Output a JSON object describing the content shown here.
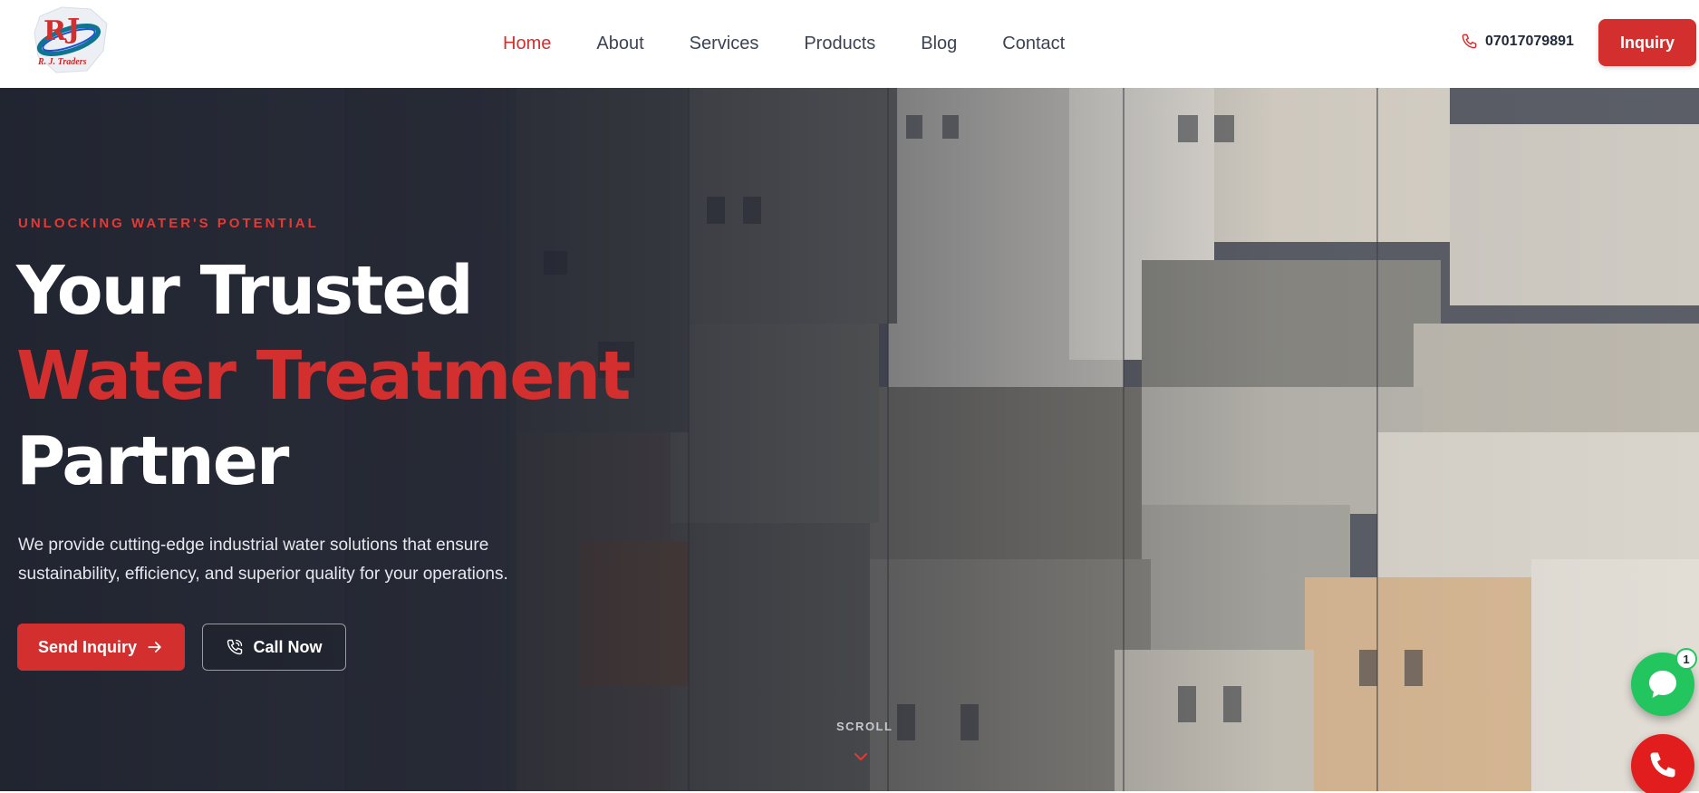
{
  "header": {
    "logo": {
      "mark": "RJ",
      "name": "R. J. Traders",
      "colors": {
        "red": "#d32f2f",
        "blue": "#1d4ed8",
        "teal": "#0e7490"
      }
    },
    "nav": [
      {
        "label": "Home",
        "active": true
      },
      {
        "label": "About",
        "active": false
      },
      {
        "label": "Services",
        "active": false
      },
      {
        "label": "Products",
        "active": false
      },
      {
        "label": "Blog",
        "active": false
      },
      {
        "label": "Contact",
        "active": false
      }
    ],
    "phone": {
      "icon": "phone-icon",
      "number": "07017079891"
    },
    "inquiry_label": "Inquiry"
  },
  "hero": {
    "eyebrow": "UNLOCKING WATER'S POTENTIAL",
    "heading_line1": "Your Trusted",
    "heading_line2": "Water Treatment",
    "heading_line3": "Partner",
    "description": "We provide cutting-edge industrial water solutions that ensure sustainability, efficiency, and superior quality for your operations.",
    "primary_button": {
      "label": "Send Inquiry",
      "icon": "arrow-right-icon"
    },
    "secondary_button": {
      "label": "Call Now",
      "icon": "phone-call-icon"
    },
    "scroll_label": "SCROLL",
    "scroll_icon": "chevron-down-icon",
    "background": "aerial-city-rooftops"
  },
  "floating": {
    "whatsapp": {
      "icon": "chat-bubble-icon",
      "badge": "1"
    },
    "call": {
      "icon": "phone-icon"
    }
  },
  "colors": {
    "accent": "#d32f2f",
    "whatsapp": "#22c55e",
    "call": "#e11d1d",
    "nav_text": "#3b4454"
  }
}
